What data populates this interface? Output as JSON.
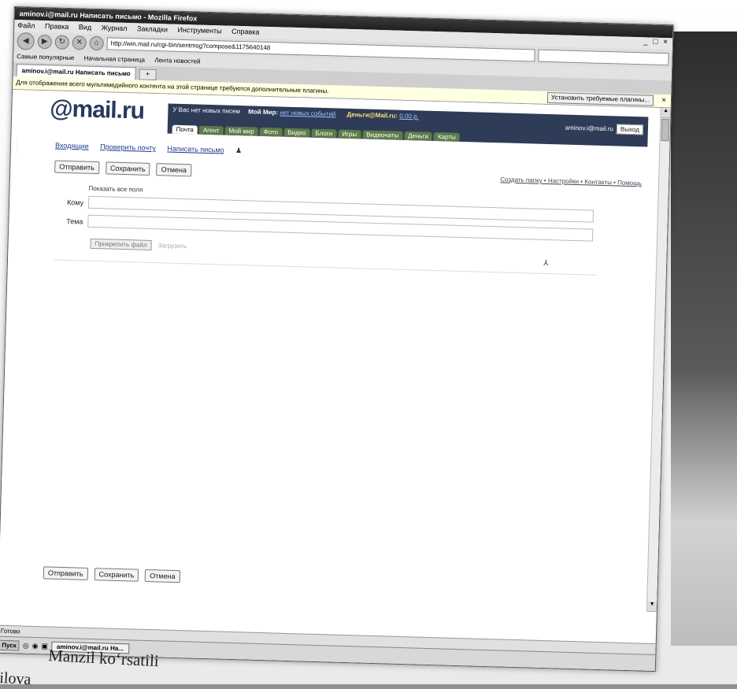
{
  "window": {
    "title": "aminov.i@mail.ru Написать письмо - Mozilla Firefox",
    "controls": "_ □ ×"
  },
  "menubar": [
    "Файл",
    "Правка",
    "Вид",
    "Журнал",
    "Закладки",
    "Инструменты",
    "Справка"
  ],
  "navigation": {
    "url": "http://win.mail.ru/cgi-bin/sentmsg?compose&1175640148",
    "search_placeholder": "",
    "back_icon": "back-arrow-icon",
    "forward_icon": "forward-arrow-icon"
  },
  "bookmarks": [
    "Самые популярные",
    "Начальная страница",
    "Лента новостей"
  ],
  "browser_tabs": [
    {
      "label": "aminov.i@mail.ru Написать письмо"
    }
  ],
  "infobar": {
    "text": "Для отображения всего мультимедийного контента на этой странице требуются дополнительные плагины.",
    "install_label": "Установить требуемые плагины..."
  },
  "mail": {
    "logo": "@mail.ru",
    "topline": {
      "new_letters": "У Вас нет новых писем",
      "my_world": "Мой Мир:",
      "my_world_link": "нет новых событий",
      "money": "Деньги@Mail.ru:",
      "money_value": "0.00 р."
    },
    "user_email": "aminov.i@mail.ru",
    "exit_label": "Выход",
    "portal_tabs": [
      "Почта",
      "Агент",
      "Мой мир",
      "Фото",
      "Видео",
      "Блоги",
      "Игры",
      "Видеочаты",
      "Деньги",
      "Карты"
    ],
    "toolbar": {
      "inbox": "Входящие",
      "check_mail": "Проверить почту",
      "compose": "Написать письмо"
    },
    "actions": {
      "send": "Отправить",
      "save": "Сохранить",
      "cancel": "Отмена"
    },
    "right_links": "Создать папку • Настройки • Контакты • Помощь",
    "compose": {
      "show_all": "Показать все поля",
      "to_label": "Кому",
      "to_value": "",
      "subject_label": "Тема",
      "subject_value": "",
      "attach_button": "Прикрепить файл",
      "attach_more": "Загрузить"
    }
  },
  "statusbar": {
    "text": "Готово"
  },
  "taskbar": {
    "start": "Пуск",
    "item": "aminov.i@mail.ru Ha..."
  },
  "caption": {
    "line1": "Manzil ko‘rsatili",
    "line2": "ilova"
  },
  "colors": {
    "mail_dark_bar": "#2e3c57",
    "portal_tab_green": "#5e7b4a",
    "link_blue": "#1a3a88"
  }
}
